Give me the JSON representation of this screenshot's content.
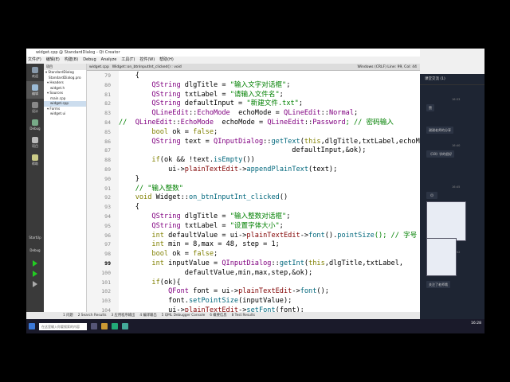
{
  "window": {
    "title": "widget.cpp @ StandardDialog - Qt Creator"
  },
  "notification": "正在共享屏幕 00:75:28",
  "menu": [
    "文件(F)",
    "编辑(E)",
    "构建(B)",
    "Debug",
    "Analyze",
    "工具(T)",
    "控件(W)",
    "帮助(H)"
  ],
  "modes": [
    {
      "label": "欢迎",
      "color": "#8899aa"
    },
    {
      "label": "编辑",
      "color": "#9bbbd6"
    },
    {
      "label": "设计",
      "color": "#888"
    },
    {
      "label": "Debug",
      "color": "#7a8"
    },
    {
      "label": "项目",
      "color": "#bbb"
    },
    {
      "label": "帮助",
      "color": "#cc8"
    }
  ],
  "mode_bottom": [
    "StartUp",
    "Debug"
  ],
  "sidebar": {
    "header": "项目",
    "items": [
      "StandardDialog",
      "StandardDialog.pro",
      "Headers",
      "widget.h",
      "Sources",
      "main.cpp",
      "widget.cpp",
      "Forms",
      "widget.ui"
    ]
  },
  "editor": {
    "tabs": [
      "widget.cpp",
      "Widget::on_btnInputInt_clicked() : void"
    ],
    "status": "Windows (CRLF)   Line: 99, Col: 44",
    "line_numbers": [
      "79",
      "80",
      "81",
      "82",
      "83",
      "84",
      "85",
      "86",
      "87",
      "88",
      "89",
      "90",
      "91",
      "92",
      "93",
      "94",
      "95",
      "96",
      "97",
      "98",
      "99",
      "100",
      "101",
      "102",
      "103",
      "104"
    ],
    "lines": [
      [
        {
          "t": "    {",
          "c": ""
        }
      ],
      [
        {
          "t": "        ",
          "c": ""
        },
        {
          "t": "QString",
          "c": "t"
        },
        {
          "t": " dlgTitle = ",
          "c": ""
        },
        {
          "t": "\"输入文字对话框\"",
          "c": "s"
        },
        {
          "t": ";",
          "c": ""
        }
      ],
      [
        {
          "t": "        ",
          "c": ""
        },
        {
          "t": "QString",
          "c": "t"
        },
        {
          "t": " txtLabel = ",
          "c": ""
        },
        {
          "t": "\"请输入文件名\"",
          "c": "s"
        },
        {
          "t": ";",
          "c": ""
        }
      ],
      [
        {
          "t": "        ",
          "c": ""
        },
        {
          "t": "QString",
          "c": "t"
        },
        {
          "t": " defaultInput = ",
          "c": ""
        },
        {
          "t": "\"新建文件.txt\"",
          "c": "s"
        },
        {
          "t": ";",
          "c": ""
        }
      ],
      [
        {
          "t": "        ",
          "c": ""
        },
        {
          "t": "QLineEdit",
          "c": "t"
        },
        {
          "t": "::",
          "c": ""
        },
        {
          "t": "EchoMode",
          "c": "t"
        },
        {
          "t": "  echoMode = ",
          "c": ""
        },
        {
          "t": "QLineEdit",
          "c": "t"
        },
        {
          "t": "::",
          "c": ""
        },
        {
          "t": "Normal",
          "c": "t"
        },
        {
          "t": ";",
          "c": ""
        }
      ],
      [
        {
          "t": "//  ",
          "c": "c"
        },
        {
          "t": "QLineEdit",
          "c": "t"
        },
        {
          "t": "::",
          "c": ""
        },
        {
          "t": "EchoMode",
          "c": "t"
        },
        {
          "t": "  echoMode = ",
          "c": ""
        },
        {
          "t": "QLineEdit",
          "c": "t"
        },
        {
          "t": "::",
          "c": ""
        },
        {
          "t": "Password",
          "c": "t"
        },
        {
          "t": "; // 密码输入",
          "c": "c"
        }
      ],
      [
        {
          "t": "        ",
          "c": ""
        },
        {
          "t": "bool",
          "c": "k"
        },
        {
          "t": " ok = ",
          "c": ""
        },
        {
          "t": "false",
          "c": "k"
        },
        {
          "t": ";",
          "c": ""
        }
      ],
      [
        {
          "t": "        ",
          "c": ""
        },
        {
          "t": "QString",
          "c": "t"
        },
        {
          "t": " text = ",
          "c": ""
        },
        {
          "t": "QInputDialog",
          "c": "t"
        },
        {
          "t": "::",
          "c": ""
        },
        {
          "t": "getText",
          "c": "f"
        },
        {
          "t": "(",
          "c": ""
        },
        {
          "t": "this",
          "c": "k"
        },
        {
          "t": ",dlgTitle,txtLabel,echoMode,",
          "c": ""
        }
      ],
      [
        {
          "t": "                                          defaultInput,&ok);",
          "c": ""
        }
      ],
      [
        {
          "t": "        ",
          "c": ""
        },
        {
          "t": "if",
          "c": "k"
        },
        {
          "t": "(ok && !text.",
          "c": ""
        },
        {
          "t": "isEmpty",
          "c": "f"
        },
        {
          "t": "())",
          "c": ""
        }
      ],
      [
        {
          "t": "            ui->",
          "c": ""
        },
        {
          "t": "plainTextEdit",
          "c": "m"
        },
        {
          "t": "->",
          "c": ""
        },
        {
          "t": "appendPlainText",
          "c": "f"
        },
        {
          "t": "(text);",
          "c": ""
        }
      ],
      [
        {
          "t": "    }",
          "c": ""
        }
      ],
      [
        {
          "t": "    // \"输入整数\"",
          "c": "c"
        }
      ],
      [
        {
          "t": "    ",
          "c": ""
        },
        {
          "t": "void",
          "c": "k"
        },
        {
          "t": " Widget::",
          "c": ""
        },
        {
          "t": "on_btnInputInt_clicked",
          "c": "f"
        },
        {
          "t": "()",
          "c": ""
        }
      ],
      [
        {
          "t": "    {",
          "c": ""
        }
      ],
      [
        {
          "t": "        ",
          "c": ""
        },
        {
          "t": "QString",
          "c": "t"
        },
        {
          "t": " dlgTitle = ",
          "c": ""
        },
        {
          "t": "\"输入整数对话框\"",
          "c": "s"
        },
        {
          "t": ";",
          "c": ""
        }
      ],
      [
        {
          "t": "        ",
          "c": ""
        },
        {
          "t": "QString",
          "c": "t"
        },
        {
          "t": " txtLabel = ",
          "c": ""
        },
        {
          "t": "\"设置字体大小\"",
          "c": "s"
        },
        {
          "t": ";",
          "c": ""
        }
      ],
      [
        {
          "t": "        ",
          "c": ""
        },
        {
          "t": "int",
          "c": "k"
        },
        {
          "t": " defaultValue = ui->",
          "c": ""
        },
        {
          "t": "plainTextEdit",
          "c": "m"
        },
        {
          "t": "->",
          "c": ""
        },
        {
          "t": "font",
          "c": "f"
        },
        {
          "t": "().",
          "c": ""
        },
        {
          "t": "pointSize",
          "c": "f"
        },
        {
          "t": "(); // 字号",
          "c": "c"
        }
      ],
      [
        {
          "t": "        ",
          "c": ""
        },
        {
          "t": "int",
          "c": "k"
        },
        {
          "t": " min = 8,max = 48, step = 1;",
          "c": ""
        }
      ],
      [
        {
          "t": "        ",
          "c": ""
        },
        {
          "t": "bool",
          "c": "k"
        },
        {
          "t": " ok = ",
          "c": ""
        },
        {
          "t": "false",
          "c": "k"
        },
        {
          "t": ";",
          "c": ""
        }
      ],
      [
        {
          "t": "        ",
          "c": ""
        },
        {
          "t": "int",
          "c": "k"
        },
        {
          "t": " inputValue = ",
          "c": ""
        },
        {
          "t": "QInputDialog",
          "c": "t"
        },
        {
          "t": "::",
          "c": ""
        },
        {
          "t": "getInt",
          "c": "f"
        },
        {
          "t": "(",
          "c": ""
        },
        {
          "t": "this",
          "c": "k"
        },
        {
          "t": ",dlgTitle,txtLabel,",
          "c": ""
        }
      ],
      [
        {
          "t": "                defaultValue,min,max,step,&ok);",
          "c": ""
        }
      ],
      [
        {
          "t": "        ",
          "c": ""
        },
        {
          "t": "if",
          "c": "k"
        },
        {
          "t": "(ok){",
          "c": ""
        }
      ],
      [
        {
          "t": "            ",
          "c": ""
        },
        {
          "t": "QFont",
          "c": "t"
        },
        {
          "t": " font = ui->",
          "c": ""
        },
        {
          "t": "plainTextEdit",
          "c": "m"
        },
        {
          "t": "->",
          "c": ""
        },
        {
          "t": "font",
          "c": "f"
        },
        {
          "t": "();",
          "c": ""
        }
      ],
      [
        {
          "t": "            font.",
          "c": ""
        },
        {
          "t": "setPointSize",
          "c": "f"
        },
        {
          "t": "(inputValue);",
          "c": ""
        }
      ],
      [
        {
          "t": "            ui->",
          "c": ""
        },
        {
          "t": "plainTextEdit",
          "c": "m"
        },
        {
          "t": "->",
          "c": ""
        },
        {
          "t": "setFont",
          "c": "f"
        },
        {
          "t": "(font);",
          "c": ""
        }
      ],
      [
        {
          "t": "        }",
          "c": ""
        }
      ],
      [
        {
          "t": "    }",
          "c": ""
        }
      ]
    ]
  },
  "bottom_tabs": [
    "1 问题",
    "2 Search Results",
    "3 应用程序输出",
    "4 编译输出",
    "5 QML Debugger Console",
    "6 概要信息",
    "8 Test Results"
  ],
  "taskbar": {
    "search": "在这里输入你要搜索的内容",
    "time": "16:28"
  },
  "chat": {
    "title": "课堂交流 (1)",
    "messages": [
      "赞",
      "谢谢老师的分享",
      "《10》学的很好",
      "《》",
      "34.39限制",
      "关注了老师哦"
    ],
    "times": [
      "16:33",
      "16:40",
      "16:45",
      "16:52"
    ]
  }
}
